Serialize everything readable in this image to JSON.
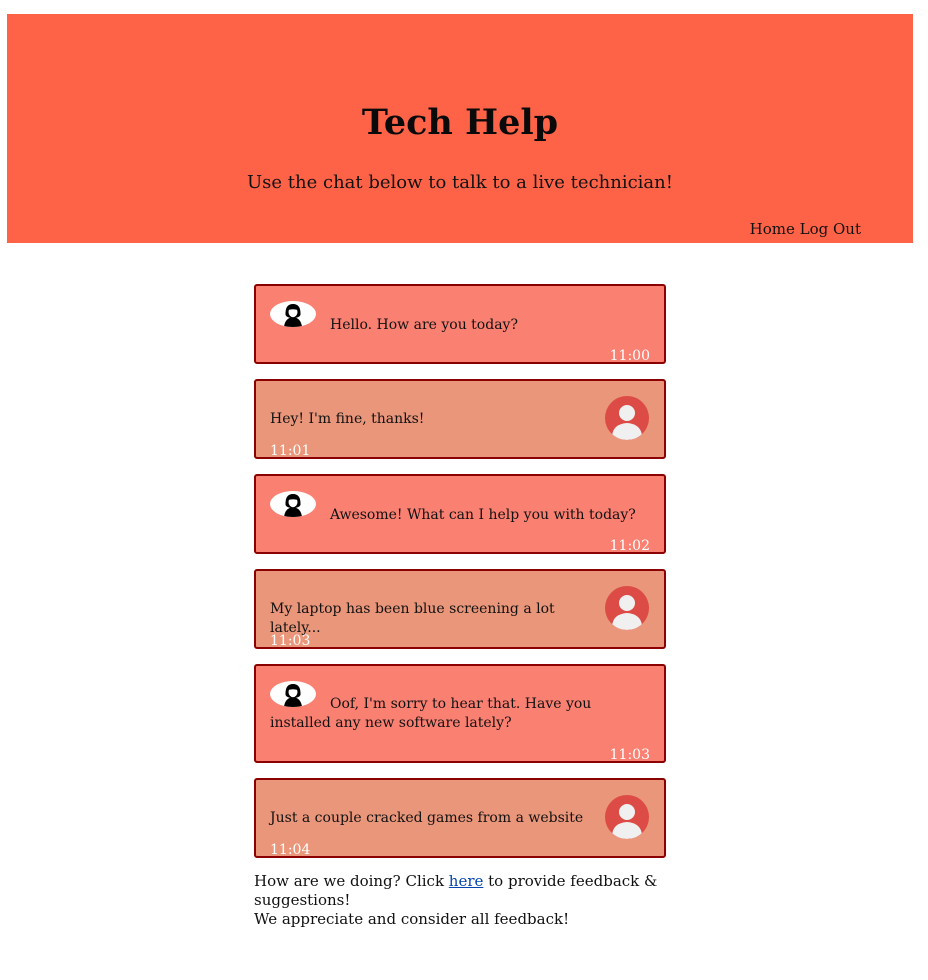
{
  "header": {
    "title": "Tech Help",
    "subtitle": "Use the chat below to talk to a live technician!",
    "nav": {
      "home": "Home",
      "logout": "Log Out"
    },
    "background_color": "#ff6347"
  },
  "messages": [
    {
      "sender": "technician",
      "text": "Hello. How are you today?",
      "time": "11:00"
    },
    {
      "sender": "user",
      "text": "Hey! I'm fine, thanks!",
      "time": "11:01"
    },
    {
      "sender": "technician",
      "text": "Awesome! What can I help you with today?",
      "time": "11:02"
    },
    {
      "sender": "user",
      "text": "My laptop has been blue screening a lot lately...",
      "time": "11:03"
    },
    {
      "sender": "technician",
      "text": "Oof, I'm sorry to hear that. Have you installed any new software lately?",
      "time": "11:03"
    },
    {
      "sender": "user",
      "text": "Just a couple cracked games from a website",
      "time": "11:04"
    }
  ],
  "footer": {
    "before_link": "How are we doing? Click ",
    "link": "here",
    "after_link": " to provide feedback & suggestions!",
    "line2": "We appreciate and consider all feedback!"
  },
  "colors": {
    "technician_bubble": "#fa8072",
    "user_bubble": "#e9967a",
    "bubble_border": "#8b0000",
    "user_avatar": "#dc4b45"
  }
}
